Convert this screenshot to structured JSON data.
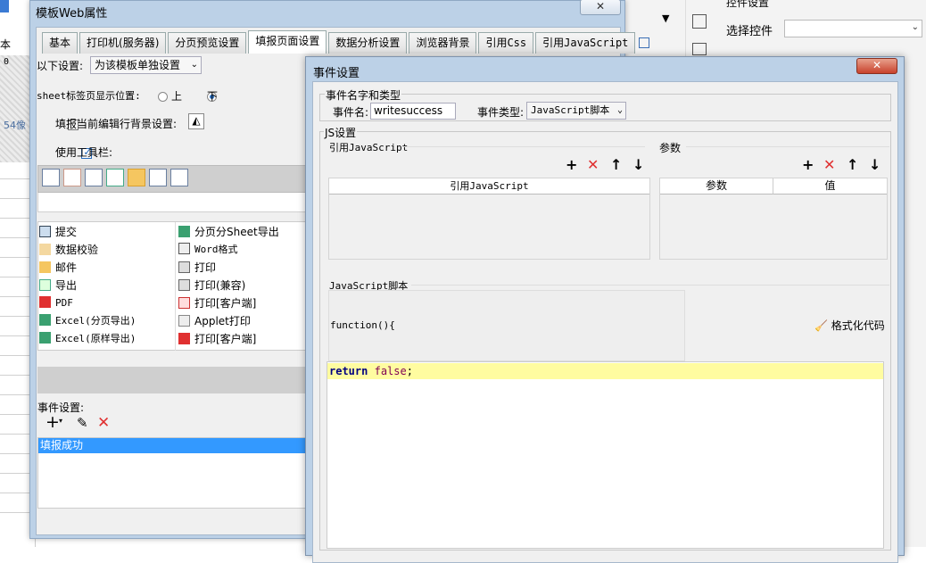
{
  "background": {
    "sheet_label": "本",
    "ruler_zero": "0",
    "pixel_hint": "54像",
    "right_panel_title": "控件设置",
    "select_control_label": "选择控件",
    "select_control_value": ""
  },
  "web_props": {
    "title": "模板Web属性",
    "close": "✕",
    "tabs": [
      "基本",
      "打印机(服务器)",
      "分页预览设置",
      "填报页面设置",
      "数据分析设置",
      "浏览器背景",
      "引用Css",
      "引用JavaScript"
    ],
    "active_tab": "填报页面设置",
    "settings_label": "以下设置:",
    "settings_value": "为该模板单独设置",
    "sheet_tab_pos_label": "sheet标签页显示位置:",
    "radio_top": "上",
    "radio_bottom": "下",
    "row_bg_label": "填报当前编辑行背景设置:",
    "use_toolbar_label": "使用工具栏:",
    "buttons_left": [
      "提交",
      "数据校验",
      "邮件",
      "导出",
      "PDF",
      "Excel(分页导出)",
      "Excel(原样导出)"
    ],
    "buttons_right": [
      "分页分Sheet导出",
      "Word格式",
      "打印",
      "打印(兼容)",
      "打印[客户端]",
      "Applet打印",
      "打印[客户端]"
    ],
    "event_settings_label": "事件设置:",
    "events": [
      "填报成功"
    ]
  },
  "event_dialog": {
    "title": "事件设置",
    "close": "✕",
    "name_type_legend": "事件名字和类型",
    "event_name_label": "事件名:",
    "event_name_value": "writesuccess",
    "event_type_label": "事件类型:",
    "event_type_value": "JavaScript脚本",
    "js_legend": "JS设置",
    "ref_js_legend": "引用JavaScript",
    "params_legend": "参数",
    "ref_js_col": "引用JavaScript",
    "param_col": "参数",
    "value_col": "值",
    "script_legend": "JavaScript脚本",
    "function_header": "function(){",
    "format_code": "格式化代码",
    "code_keyword": "return",
    "code_value": "false",
    "code_end": ";"
  },
  "colors": {
    "selection": "#3399ff",
    "code_highlight": "#fffca0",
    "delete_red": "#e03030"
  }
}
